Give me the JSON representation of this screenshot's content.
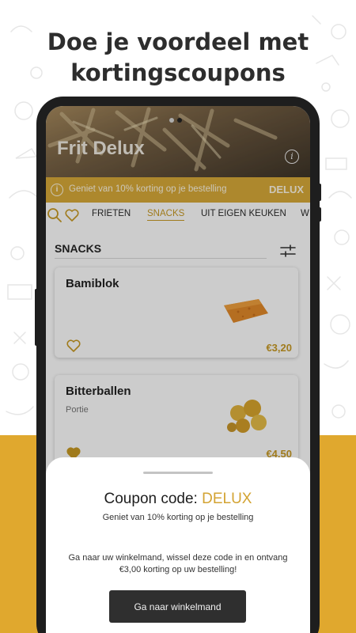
{
  "promo": {
    "headline_line1": "Doe je voordeel met",
    "headline_line2": "kortingscoupons"
  },
  "colors": {
    "accent": "#d3a332",
    "band": "#e0a82e",
    "dark": "#2f2f2f"
  },
  "restaurant": {
    "name": "Frit Delux",
    "info_icon": "info-icon"
  },
  "banner": {
    "text": "Geniet van 10% korting op je bestelling",
    "code": "DELUX"
  },
  "categories": [
    "FRIETEN",
    "SNACKS",
    "UIT EIGEN KEUKEN",
    "W"
  ],
  "active_category": "SNACKS",
  "section": {
    "title": "SNACKS"
  },
  "products": [
    {
      "name": "Bamiblok",
      "subtitle": "",
      "price": "€3,20",
      "favorite": false
    },
    {
      "name": "Bitterballen",
      "subtitle": "Portie",
      "price": "€4,50",
      "favorite": true
    }
  ],
  "coupon": {
    "label": "Coupon code: ",
    "code": "DELUX",
    "subtitle": "Geniet van 10% korting op je bestelling",
    "description": "Ga naar uw winkelmand, wissel deze code in en ontvang €3,00 korting op uw bestelling!",
    "button": "Ga naar winkelmand"
  }
}
